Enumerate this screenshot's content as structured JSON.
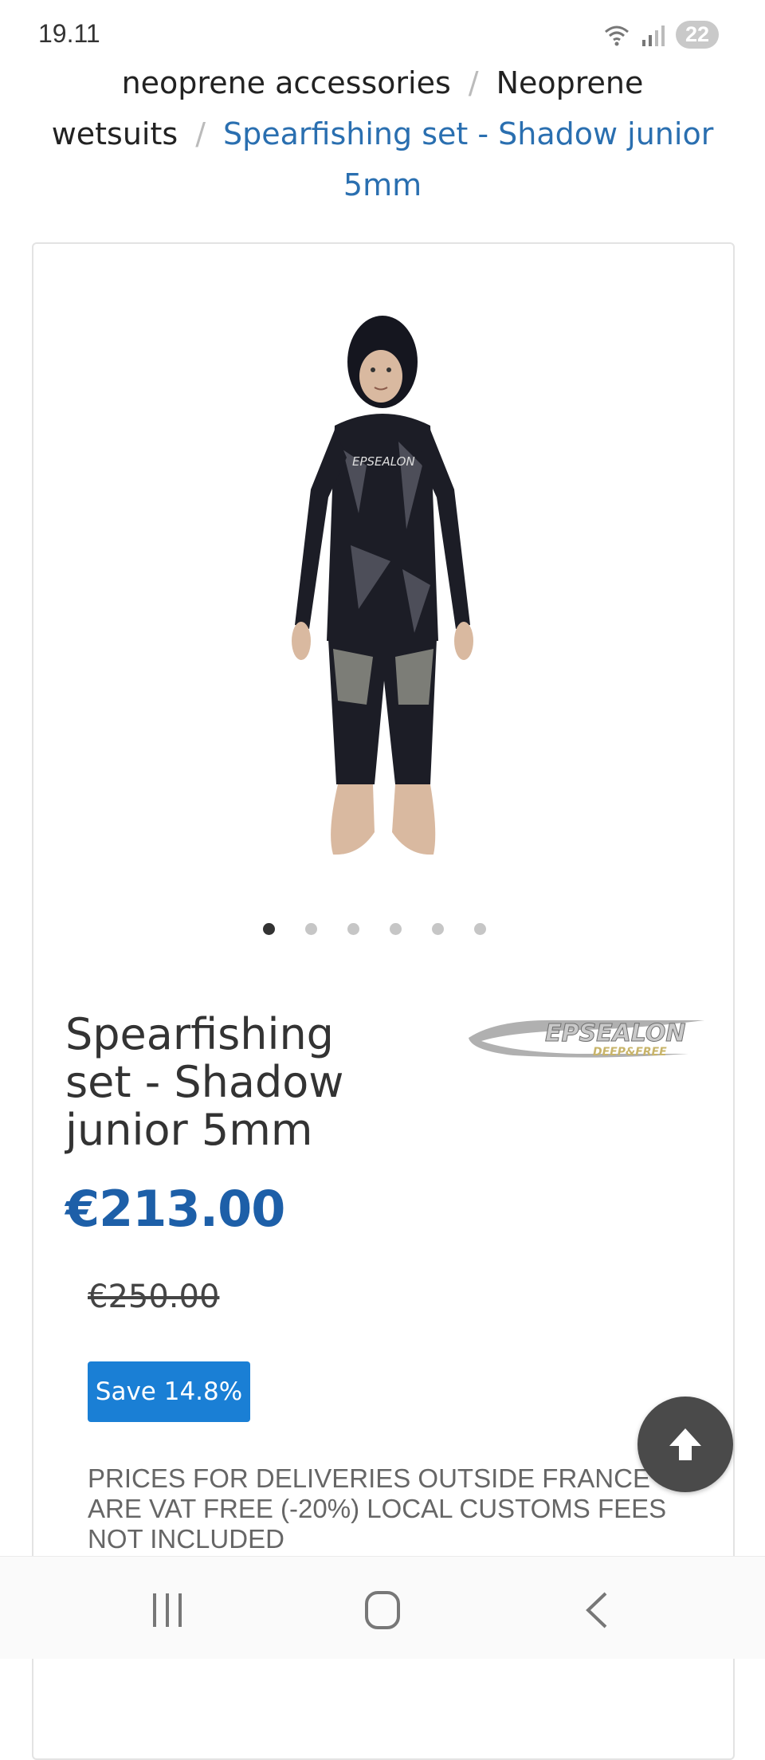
{
  "status_bar": {
    "time": "19.11",
    "battery": "22",
    "icons": [
      "wifi-icon",
      "signal-icon"
    ]
  },
  "breadcrumb": {
    "items": [
      "neoprene accessories",
      "Neoprene wetsuits"
    ],
    "current": "Spearfishing set - Shadow junior 5mm",
    "separator": "/"
  },
  "product": {
    "image_alt": "Boy wearing black camo spearfishing wetsuit",
    "carousel_count": 6,
    "carousel_active": 1,
    "title": "Spearfishing set - Shadow junior 5mm",
    "brand_text": "EPSEALON",
    "brand_sub": "DEEP&FREE",
    "price": "€213.00",
    "old_price": "€250.00",
    "save_label": "Save 14.8%",
    "notice": "Prices for deliveries outside France are VAT FREE (-20%) local customs fees not included"
  },
  "colors": {
    "accent": "#1d5fa8",
    "link": "#2a6fb0",
    "badge": "#1a7fd5"
  },
  "nav": {
    "icons": [
      "recent-apps-icon",
      "home-icon",
      "back-icon"
    ]
  }
}
